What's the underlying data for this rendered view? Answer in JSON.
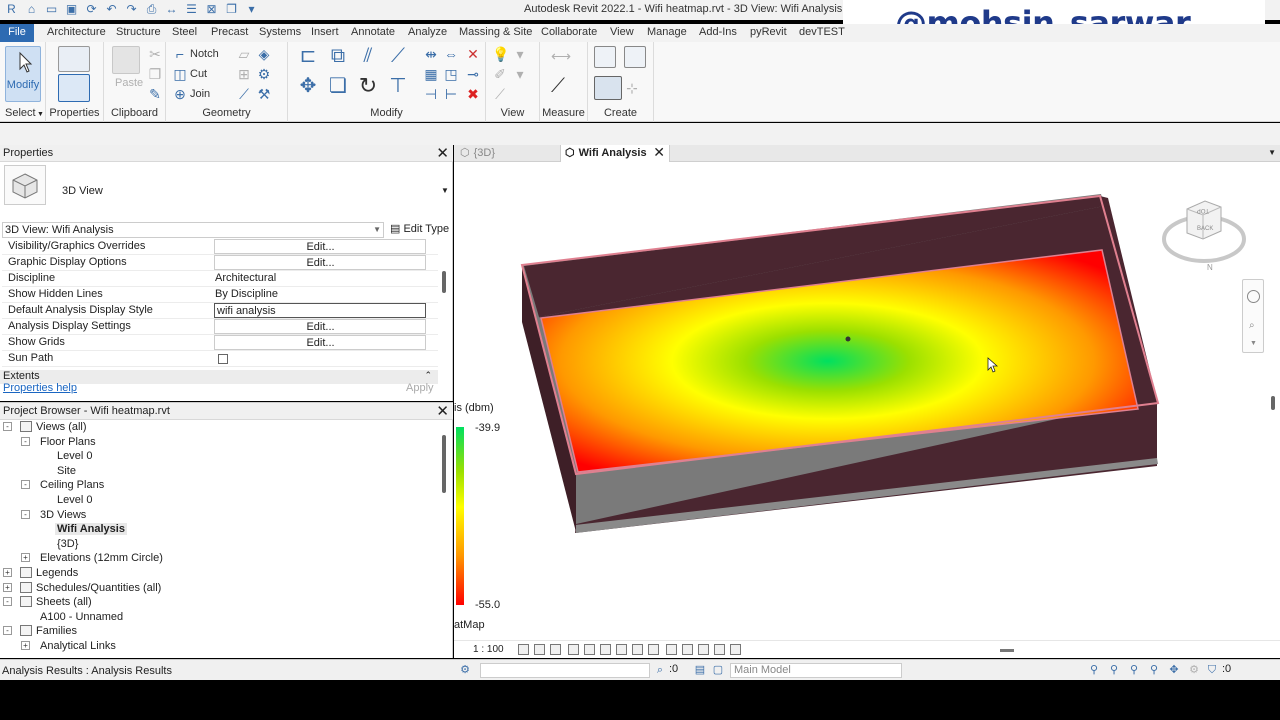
{
  "app": {
    "window_title": "Autodesk Revit 2022.1 - Wifi heatmap.rvt - 3D View: Wifi Analysis",
    "watermark": "@mohsin_sarwar"
  },
  "ribbon_tabs": [
    {
      "label": "File",
      "active": true
    },
    {
      "label": "Architecture"
    },
    {
      "label": "Structure"
    },
    {
      "label": "Steel"
    },
    {
      "label": "Precast"
    },
    {
      "label": "Systems"
    },
    {
      "label": "Insert"
    },
    {
      "label": "Annotate"
    },
    {
      "label": "Analyze"
    },
    {
      "label": "Massing & Site"
    },
    {
      "label": "Collaborate"
    },
    {
      "label": "View"
    },
    {
      "label": "Manage"
    },
    {
      "label": "Add-Ins"
    },
    {
      "label": "pyRevit"
    },
    {
      "label": "devTEST"
    }
  ],
  "ribbon": {
    "modify_label": "Modify",
    "paste_label": "Paste",
    "notch_label": "Notch",
    "cut_label": "Cut",
    "join_label": "Join",
    "groups": {
      "select": "Select",
      "properties": "Properties",
      "clipboard": "Clipboard",
      "geometry": "Geometry",
      "modify": "Modify",
      "view": "View",
      "measure": "Measure",
      "create": "Create"
    }
  },
  "properties": {
    "title": "Properties",
    "type_name": "3D View",
    "instance_selector": "3D View: Wifi Analysis",
    "edit_type": "Edit Type",
    "rows": [
      {
        "key": "Visibility/Graphics Overrides",
        "value": "Edit...",
        "kind": "button"
      },
      {
        "key": "Graphic Display Options",
        "value": "Edit...",
        "kind": "button"
      },
      {
        "key": "Discipline",
        "value": "Architectural",
        "kind": "text"
      },
      {
        "key": "Show Hidden Lines",
        "value": "By Discipline",
        "kind": "text"
      },
      {
        "key": "Default Analysis Display Style",
        "value": "wifi analysis",
        "kind": "boxed"
      },
      {
        "key": "Analysis Display Settings",
        "value": "Edit...",
        "kind": "button"
      },
      {
        "key": "Show Grids",
        "value": "Edit...",
        "kind": "button"
      },
      {
        "key": "Sun Path",
        "value": "",
        "kind": "checkbox"
      }
    ],
    "section": "Extents",
    "help_link": "Properties help",
    "apply": "Apply"
  },
  "project_browser": {
    "title": "Project Browser - Wifi heatmap.rvt",
    "nodes": [
      {
        "label": "Views (all)",
        "level": 0,
        "toggle": "-",
        "icon": true
      },
      {
        "label": "Floor Plans",
        "level": 1,
        "toggle": "-"
      },
      {
        "label": "Level 0",
        "level": 2
      },
      {
        "label": "Site",
        "level": 2
      },
      {
        "label": "Ceiling Plans",
        "level": 1,
        "toggle": "-"
      },
      {
        "label": "Level 0",
        "level": 2
      },
      {
        "label": "3D Views",
        "level": 1,
        "toggle": "-"
      },
      {
        "label": "Wifi Analysis",
        "level": 2,
        "selected": true
      },
      {
        "label": "{3D}",
        "level": 2
      },
      {
        "label": "Elevations (12mm Circle)",
        "level": 1,
        "toggle": "+"
      },
      {
        "label": "Legends",
        "level": 0,
        "toggle": "+",
        "icon": true
      },
      {
        "label": "Schedules/Quantities (all)",
        "level": 0,
        "toggle": "+",
        "icon": true
      },
      {
        "label": "Sheets (all)",
        "level": 0,
        "toggle": "-",
        "icon": true
      },
      {
        "label": "A100 - Unnamed",
        "level": 1
      },
      {
        "label": "Families",
        "level": 0,
        "toggle": "-",
        "icon": true
      },
      {
        "label": "Analytical Links",
        "level": 1,
        "toggle": "+"
      }
    ]
  },
  "view_tabs": [
    {
      "label": "{3D}",
      "active": false
    },
    {
      "label": "Wifi Analysis",
      "active": true
    }
  ],
  "legend": {
    "title": "is (dbm)",
    "max": "-39.9",
    "min": "-55.0",
    "name": "atMap"
  },
  "viewcube": {
    "top": "TOP",
    "back": "BACK",
    "north": "N"
  },
  "view_bar": {
    "scale": "1 : 100"
  },
  "status_bar": {
    "text": "Analysis Results : Analysis Results",
    "selection_count": ":0",
    "model": "Main Model",
    "filter_count": ":0"
  },
  "colors": {
    "accent": "#2e6bb2",
    "heat_hot": "#ff0000",
    "heat_mid": "#ffff00",
    "heat_cool": "#00e060",
    "wall": "#4a2630"
  }
}
